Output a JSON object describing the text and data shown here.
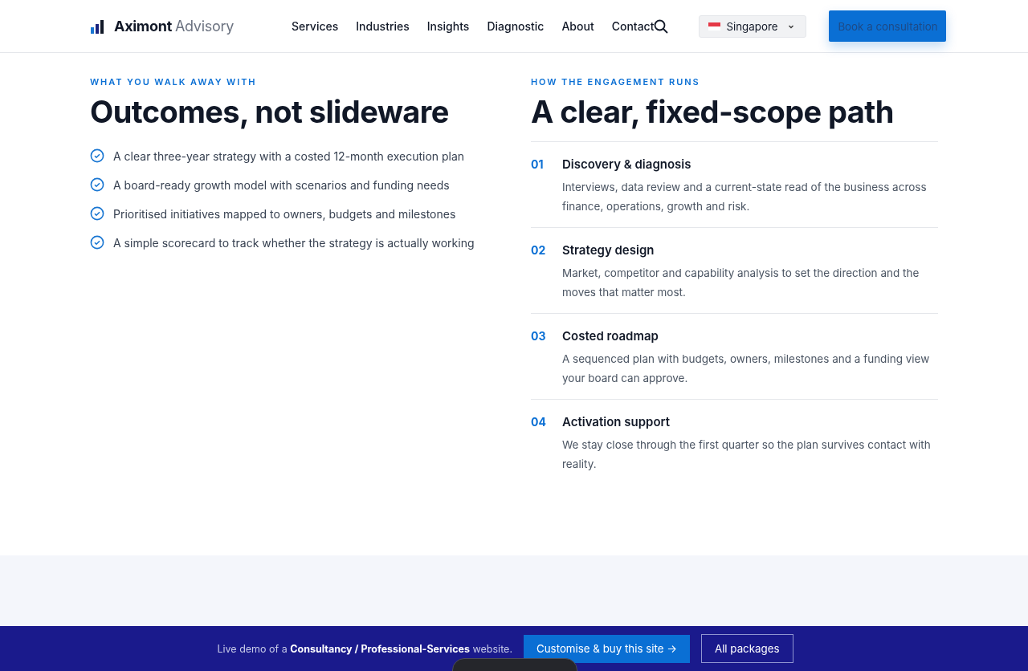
{
  "header": {
    "brand": {
      "name": "Aximont",
      "suffix": "Advisory"
    },
    "nav": [
      {
        "label": "Services"
      },
      {
        "label": "Industries"
      },
      {
        "label": "Insights"
      },
      {
        "label": "Diagnostic"
      },
      {
        "label": "About"
      },
      {
        "label": "Contact"
      }
    ],
    "region": {
      "label": "Singapore"
    },
    "cta": "Book a consultation"
  },
  "outcomes": {
    "eyebrow": "WHAT YOU WALK AWAY WITH",
    "title": "Outcomes, not slideware",
    "items": [
      "A clear three-year strategy with a costed 12-month execution plan",
      "A board-ready growth model with scenarios and funding needs",
      "Prioritised initiatives mapped to owners, budgets and milestones",
      "A simple scorecard to track whether the strategy is actually working"
    ]
  },
  "engagement": {
    "eyebrow": "HOW THE ENGAGEMENT RUNS",
    "title": "A clear, fixed-scope path",
    "steps": [
      {
        "number": "01",
        "title": "Discovery & diagnosis",
        "text": "Interviews, data review and a current-state read of the business across finance, operations, growth and risk."
      },
      {
        "number": "02",
        "title": "Strategy design",
        "text": "Market, competitor and capability analysis to set the direction and the moves that matter most."
      },
      {
        "number": "03",
        "title": "Costed roadmap",
        "text": "A sequenced plan with budgets, owners, milestones and a funding view your board can approve."
      },
      {
        "number": "04",
        "title": "Activation support",
        "text": "We stay close through the first quarter so the plan survives contact with reality."
      }
    ]
  },
  "demo_banner": {
    "text": "Live demo of a **Consultancy / Professional-Services** website.",
    "primary": "Customise & buy this site →",
    "secondary": "All packages"
  }
}
